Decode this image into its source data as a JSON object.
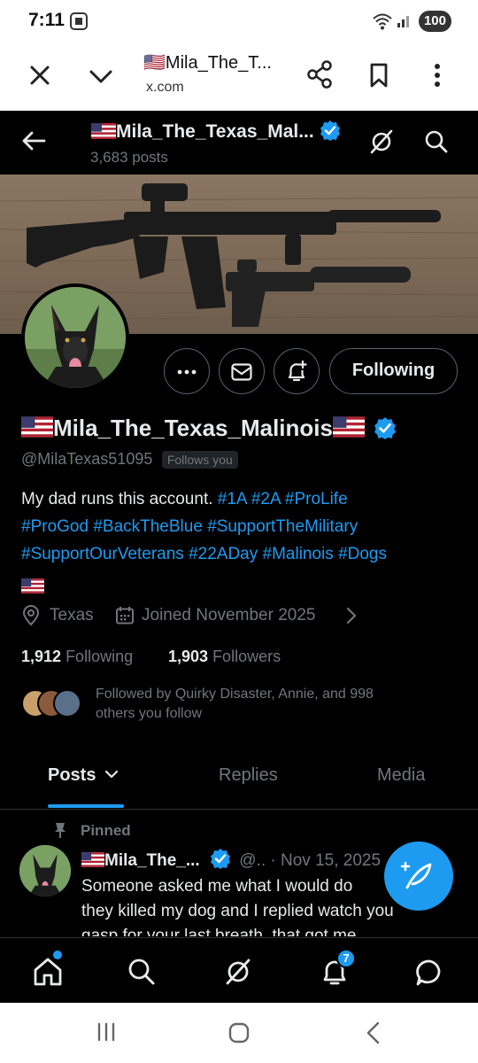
{
  "status_bar": {
    "time": "7:11",
    "battery": "100"
  },
  "browser": {
    "page_title": "🇺🇸Mila_The_T...",
    "url": "x.com"
  },
  "header": {
    "name": "Mila_The_Texas_Mal...",
    "post_count": "3,683 posts"
  },
  "profile": {
    "display_name": "Mila_The_Texas_Malinois",
    "handle": "@MilaTexas51095",
    "follows_you": "Follows you",
    "following_button": "Following",
    "bio_text": "My dad runs this account.",
    "bio_tags_line1": [
      "#1A",
      "#2A",
      "#ProLife"
    ],
    "bio_tags_line2": [
      "#ProGod",
      "#BackTheBlue",
      "#SupportTheMilitary"
    ],
    "bio_tags_line3": [
      "#SupportOurVeterans",
      "#22ADay",
      "#Malinois",
      "#Dogs"
    ],
    "location": "Texas",
    "joined": "Joined November 2025",
    "following_count": "1,912",
    "following_label": "Following",
    "followers_count": "1,903",
    "followers_label": "Followers",
    "followed_by_line1": "Followed by Quirky Disaster, Annie, and 998",
    "followed_by_line2": "others you follow"
  },
  "tabs": {
    "posts": "Posts",
    "replies": "Replies",
    "media": "Media"
  },
  "pinned_post": {
    "pinned_label": "Pinned",
    "author": "Mila_The_...",
    "handle_date": "@.. · Nov 15, 2025",
    "more": "·",
    "line1": "Someone asked me what I would do",
    "line2": "they killed my dog and I replied watch you",
    "line3": "gasp for your last breath, that got me"
  },
  "bottom_nav": {
    "notifications_badge": "7"
  },
  "colors": {
    "accent": "#1d9bf0",
    "verified": "#1d9bf0",
    "background": "#000000",
    "muted": "#71767b"
  },
  "icons": [
    "close-icon",
    "chevron-down-icon",
    "share-icon",
    "bookmark-icon",
    "more-vertical-icon",
    "back-arrow-icon",
    "grok-icon",
    "search-icon",
    "more-horizontal-icon",
    "mail-icon",
    "bell-plus-icon",
    "location-icon",
    "calendar-icon",
    "home-icon",
    "notifications-icon",
    "messages-icon",
    "compose-icon"
  ]
}
